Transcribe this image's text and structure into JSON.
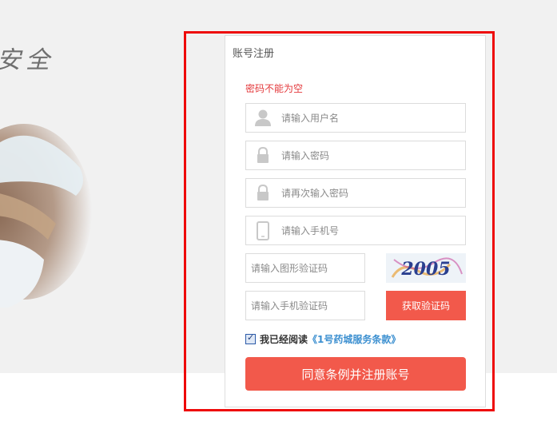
{
  "hero": {
    "slogan": "安全"
  },
  "form": {
    "title": "账号注册",
    "error": "密码不能为空",
    "username_placeholder": "请输入用户名",
    "password_placeholder": "请输入密码",
    "confirm_placeholder": "请再次输入密码",
    "phone_placeholder": "请输入手机号",
    "captcha_placeholder": "请输入图形验证码",
    "captcha_text": "2005",
    "sms_code_placeholder": "请输入手机验证码",
    "get_code_label": "获取验证码",
    "agree_checked": true,
    "agree_text": "我已经阅读",
    "terms_link": "《1号药城服务条款》",
    "submit_label": "同意条例并注册账号"
  },
  "colors": {
    "accent": "#f2594b",
    "error": "#e4393c",
    "link": "#3b8fd0",
    "highlight": "#ee0a0a"
  },
  "icons": {
    "username": "user-icon",
    "password": "lock-icon",
    "confirm": "lock-icon",
    "phone": "phone-icon"
  }
}
